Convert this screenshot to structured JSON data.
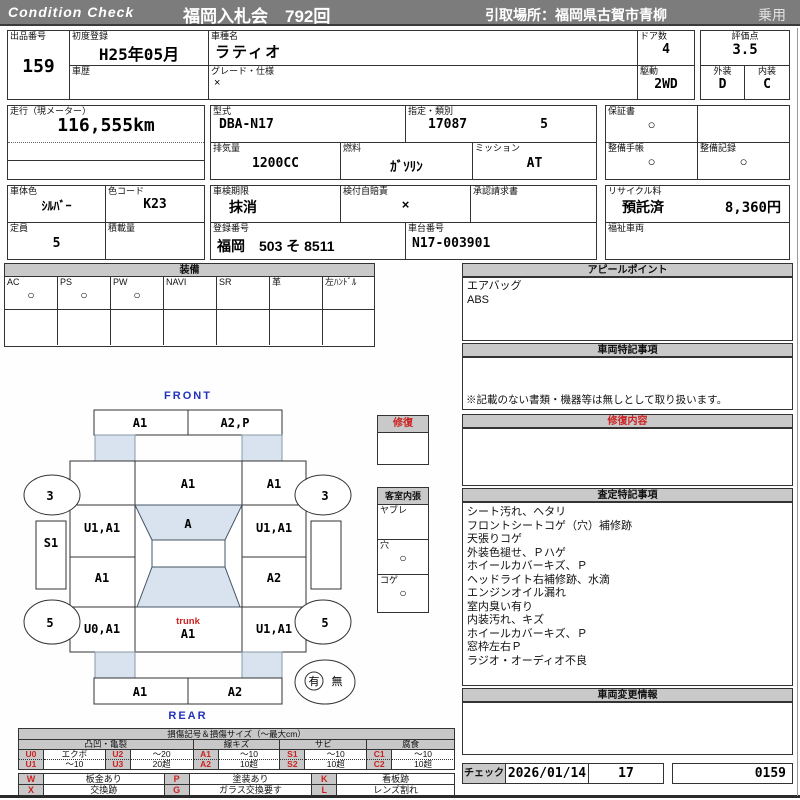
{
  "colors": {
    "header_gray": "#7c7c7c",
    "bar_gray": "#c9c9c9",
    "shade_blue": "#d9e2ef",
    "accent_red": "#cc2222",
    "front_rear_blue": "#2233bb"
  },
  "header": {
    "brand": "Condition Check",
    "auction_title": "福岡入札会　792回",
    "pickup_location": "引取場所：福岡県古賀市青柳",
    "vehicle_class": "乗用"
  },
  "info": {
    "lot": {
      "label": "出品番号",
      "value": "159"
    },
    "first_registration": {
      "label": "初度登録",
      "value": "H25年05月"
    },
    "history": {
      "label": "車歴",
      "value": ""
    },
    "model_name": {
      "label": "車種名",
      "value": "ラティオ"
    },
    "grade": {
      "label": "グレード・仕様",
      "value": "×"
    },
    "doors": {
      "label": "ドア数",
      "value": "4"
    },
    "drive": {
      "label": "駆動",
      "value": "2WD"
    },
    "score": {
      "label": "評価点",
      "value": "3.5"
    },
    "exterior": {
      "label": "外装",
      "value": "D"
    },
    "interior": {
      "label": "内装",
      "value": "C"
    },
    "mileage": {
      "label": "走行（現メーター）",
      "value": "116,555km"
    },
    "model_code": {
      "label": "型式",
      "value": "DBA-N17"
    },
    "type_class": {
      "label": "指定・類別",
      "type_no": "17087",
      "class_no": "5"
    },
    "displacement": {
      "label": "排気量",
      "value": "1200CC"
    },
    "fuel": {
      "label": "燃料",
      "value": "ｶﾞｿﾘﾝ"
    },
    "mission": {
      "label": "ミッション",
      "value": "AT"
    },
    "warranty": {
      "label": "保証書",
      "value": "○"
    },
    "maintenance_book": {
      "label": "整備手帳",
      "value": "○"
    },
    "maintenance_record": {
      "label": "整備記録",
      "value": "○"
    },
    "body_color": {
      "label": "車体色",
      "value": "ｼﾙﾊﾞｰ"
    },
    "color_code": {
      "label": "色コード",
      "value": "K23"
    },
    "inspection_expiry": {
      "label": "車検期限",
      "value": "抹消"
    },
    "insurance": {
      "label": "検付自賠責",
      "value": "×"
    },
    "approval_request": {
      "label": "承認請求書",
      "value": ""
    },
    "recycle": {
      "label": "リサイクル料",
      "status": "預託済",
      "fee": "8,360円"
    },
    "capacity": {
      "label": "定員",
      "value": "5"
    },
    "load": {
      "label": "積載量",
      "value": ""
    },
    "registration_no": {
      "label": "登録番号",
      "value": "福岡　503 そ 8511"
    },
    "chassis_no": {
      "label": "車台番号",
      "value": "N17-003901"
    },
    "welfare": {
      "label": "福祉車両",
      "value": ""
    }
  },
  "equipment": {
    "title": "装備",
    "items": [
      {
        "label": "AC",
        "value": "○"
      },
      {
        "label": "PS",
        "value": "○"
      },
      {
        "label": "PW",
        "value": "○"
      },
      {
        "label": "NAVI",
        "value": ""
      },
      {
        "label": "SR",
        "value": ""
      },
      {
        "label": "革",
        "value": ""
      },
      {
        "label": "左ﾊﾝﾄﾞﾙ",
        "value": ""
      }
    ]
  },
  "appeal": {
    "title": "アピールポイント",
    "lines": [
      "エアバッグ",
      "ABS"
    ]
  },
  "vehicle_notes": {
    "title": "車両特記事項",
    "note": "※記載のない書類・機器等は無しとして取り扱います。"
  },
  "repair": {
    "title": "修復"
  },
  "repair_detail": {
    "title": "修復内容"
  },
  "cabin_lining": {
    "title": "客室内張",
    "items": [
      {
        "label": "ヤブレ",
        "value": ""
      },
      {
        "label": "穴",
        "value": "○"
      },
      {
        "label": "コゲ",
        "value": "○"
      }
    ]
  },
  "assessment": {
    "title": "査定特記事項",
    "lines": [
      "シート汚れ、ヘタリ",
      "フロントシートコゲ（穴）補修跡",
      "天張りコゲ",
      "外装色褪せ、Ｐハゲ",
      "ホイールカバーキズ、Ｐ",
      "ヘッドライト右補修跡、水滴",
      "エンジンオイル漏れ",
      "室内臭い有り",
      "内装汚れ、キズ",
      "ホイールカバーキズ、Ｐ",
      "窓枠左右Ｐ",
      "ラジオ・オーディオ不良"
    ]
  },
  "change_info": {
    "title": "車両変更情報"
  },
  "check": {
    "label": "チェック",
    "date": "2026/01/14",
    "inspector": "17",
    "serial": "0159"
  },
  "diagram": {
    "front_label": "FRONT",
    "rear_label": "REAR",
    "front_bumper_left": "A1",
    "front_bumper_right": "A2,P",
    "hood": "A1",
    "right_front_fender": "A1",
    "windshield": "A",
    "left_front_door": "U1,A1",
    "right_front_door": "U1,A1",
    "left_rear_door": "A1",
    "right_rear_door": "A2",
    "left_sill": "S1",
    "left_rear_fender": "U0,A1",
    "right_rear_fender": "U1,A1",
    "trunk_label": "trunk",
    "trunk": "A1",
    "rear_bumper_left": "A1",
    "rear_bumper_right": "A2",
    "front_left_wheel": "3",
    "front_right_wheel": "3",
    "rear_left_wheel": "5",
    "rear_right_wheel": "5",
    "record_yes": "有",
    "record_no": "無"
  },
  "legend": {
    "title": "損傷記号＆損傷サイズ（～最大cm）",
    "categories": [
      "凸凹・亀裂",
      "線キズ",
      "サビ",
      "腐食"
    ],
    "row1": [
      {
        "code": "U0",
        "desc": "エクボ"
      },
      {
        "code": "U2",
        "desc": "～20"
      },
      {
        "code": "A1",
        "desc": "～10"
      },
      {
        "code": "S1",
        "desc": "～10"
      },
      {
        "code": "C1",
        "desc": "～10"
      }
    ],
    "row2": [
      {
        "code": "U1",
        "desc": "～10"
      },
      {
        "code": "U3",
        "desc": "20超"
      },
      {
        "code": "A2",
        "desc": "10超"
      },
      {
        "code": "S2",
        "desc": "10超"
      },
      {
        "code": "C2",
        "desc": "10超"
      }
    ],
    "row3": [
      {
        "code": "W",
        "desc": "板金あり"
      },
      {
        "code": "P",
        "desc": "塗装あり"
      },
      {
        "code": "K",
        "desc": "看板跡"
      }
    ],
    "row4": [
      {
        "code": "X",
        "desc": "交換跡"
      },
      {
        "code": "G",
        "desc": "ガラス交換要す"
      },
      {
        "code": "L",
        "desc": "レンズ割れ"
      }
    ]
  }
}
